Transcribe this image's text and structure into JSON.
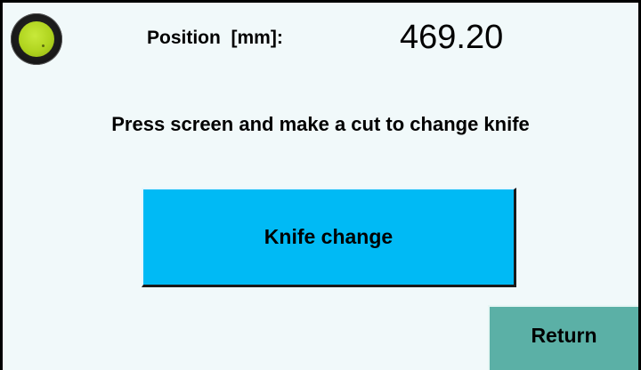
{
  "header": {
    "position_label": "Position  [mm]:",
    "position_value": "469.20",
    "status_indicator": {
      "icon": "status-lamp-icon",
      "state": "on",
      "color": "#b0d41f"
    }
  },
  "main": {
    "instruction": "Press screen and make a cut to change knife",
    "knife_change_label": "Knife change",
    "knife_change_color": "#00baf5"
  },
  "footer": {
    "return_label": "Return",
    "return_color": "#5bb0a6"
  },
  "colors": {
    "background": "#f1f9fa",
    "frame": "#000000"
  }
}
